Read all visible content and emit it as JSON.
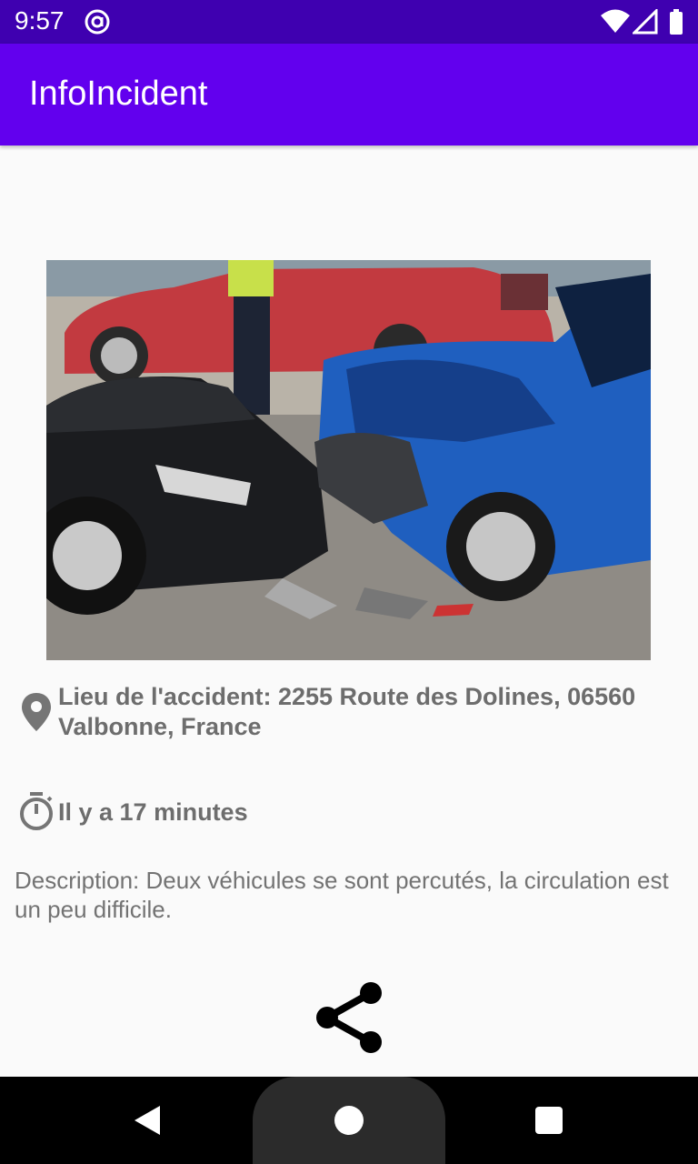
{
  "status_bar": {
    "time": "9:57",
    "app_icon": "at-sign-icon",
    "wifi_icon": "wifi-icon",
    "signal_icon": "cell-signal-icon",
    "battery_icon": "battery-icon"
  },
  "app_bar": {
    "title": "InfoIncident",
    "color": "#6200ee"
  },
  "incident": {
    "photo_icon": "car-accident-photo",
    "location_icon": "location-pin-icon",
    "location": "Lieu de l'accident: 2255 Route des Dolines, 06560 Valbonne, France",
    "time_icon": "timer-icon",
    "time": "Il y a 17 minutes",
    "description": "Description: Deux véhicules se sont percutés, la circulation est un peu difficile."
  },
  "actions": {
    "share_icon": "share-icon"
  },
  "nav_bar": {
    "back_icon": "back-triangle-icon",
    "home_icon": "home-circle-icon",
    "recents_icon": "recents-square-icon"
  }
}
